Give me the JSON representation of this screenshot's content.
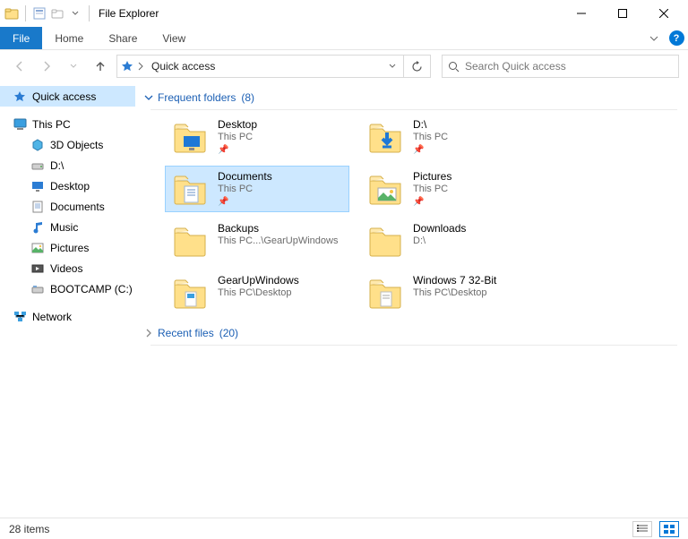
{
  "window": {
    "title": "File Explorer"
  },
  "ribbon": {
    "file": "File",
    "tabs": [
      "Home",
      "Share",
      "View"
    ],
    "help": "?"
  },
  "nav": {
    "crumb": "Quick access",
    "search_placeholder": "Search Quick access"
  },
  "sidebar": {
    "quick_access": "Quick access",
    "this_pc": "This PC",
    "this_pc_children": [
      {
        "label": "3D Objects",
        "icon": "objects"
      },
      {
        "label": "D:\\",
        "icon": "drive"
      },
      {
        "label": "Desktop",
        "icon": "desktop"
      },
      {
        "label": "Documents",
        "icon": "documents"
      },
      {
        "label": "Music",
        "icon": "music"
      },
      {
        "label": "Pictures",
        "icon": "pictures"
      },
      {
        "label": "Videos",
        "icon": "videos"
      },
      {
        "label": "BOOTCAMP (C:)",
        "icon": "drive-c"
      }
    ],
    "network": "Network"
  },
  "sections": {
    "frequent": {
      "title": "Frequent folders",
      "count": "(8)"
    },
    "recent": {
      "title": "Recent files",
      "count": "(20)"
    }
  },
  "folders": [
    {
      "name": "Desktop",
      "sub": "This PC",
      "pinned": true,
      "icon": "desktop"
    },
    {
      "name": "D:\\",
      "sub": "This PC",
      "pinned": true,
      "icon": "downloads"
    },
    {
      "name": "Documents",
      "sub": "This PC",
      "pinned": true,
      "icon": "documents",
      "selected": true
    },
    {
      "name": "Pictures",
      "sub": "This PC",
      "pinned": true,
      "icon": "pictures"
    },
    {
      "name": "Backups",
      "sub": "This PC...\\GearUpWindows",
      "pinned": false,
      "icon": "folder"
    },
    {
      "name": "Downloads",
      "sub": "D:\\",
      "pinned": false,
      "icon": "folder"
    },
    {
      "name": "GearUpWindows",
      "sub": "This PC\\Desktop",
      "pinned": false,
      "icon": "folder-app"
    },
    {
      "name": "Windows 7 32-Bit",
      "sub": "This PC\\Desktop",
      "pinned": false,
      "icon": "folder-doc"
    }
  ],
  "status": {
    "items": "28 items"
  }
}
